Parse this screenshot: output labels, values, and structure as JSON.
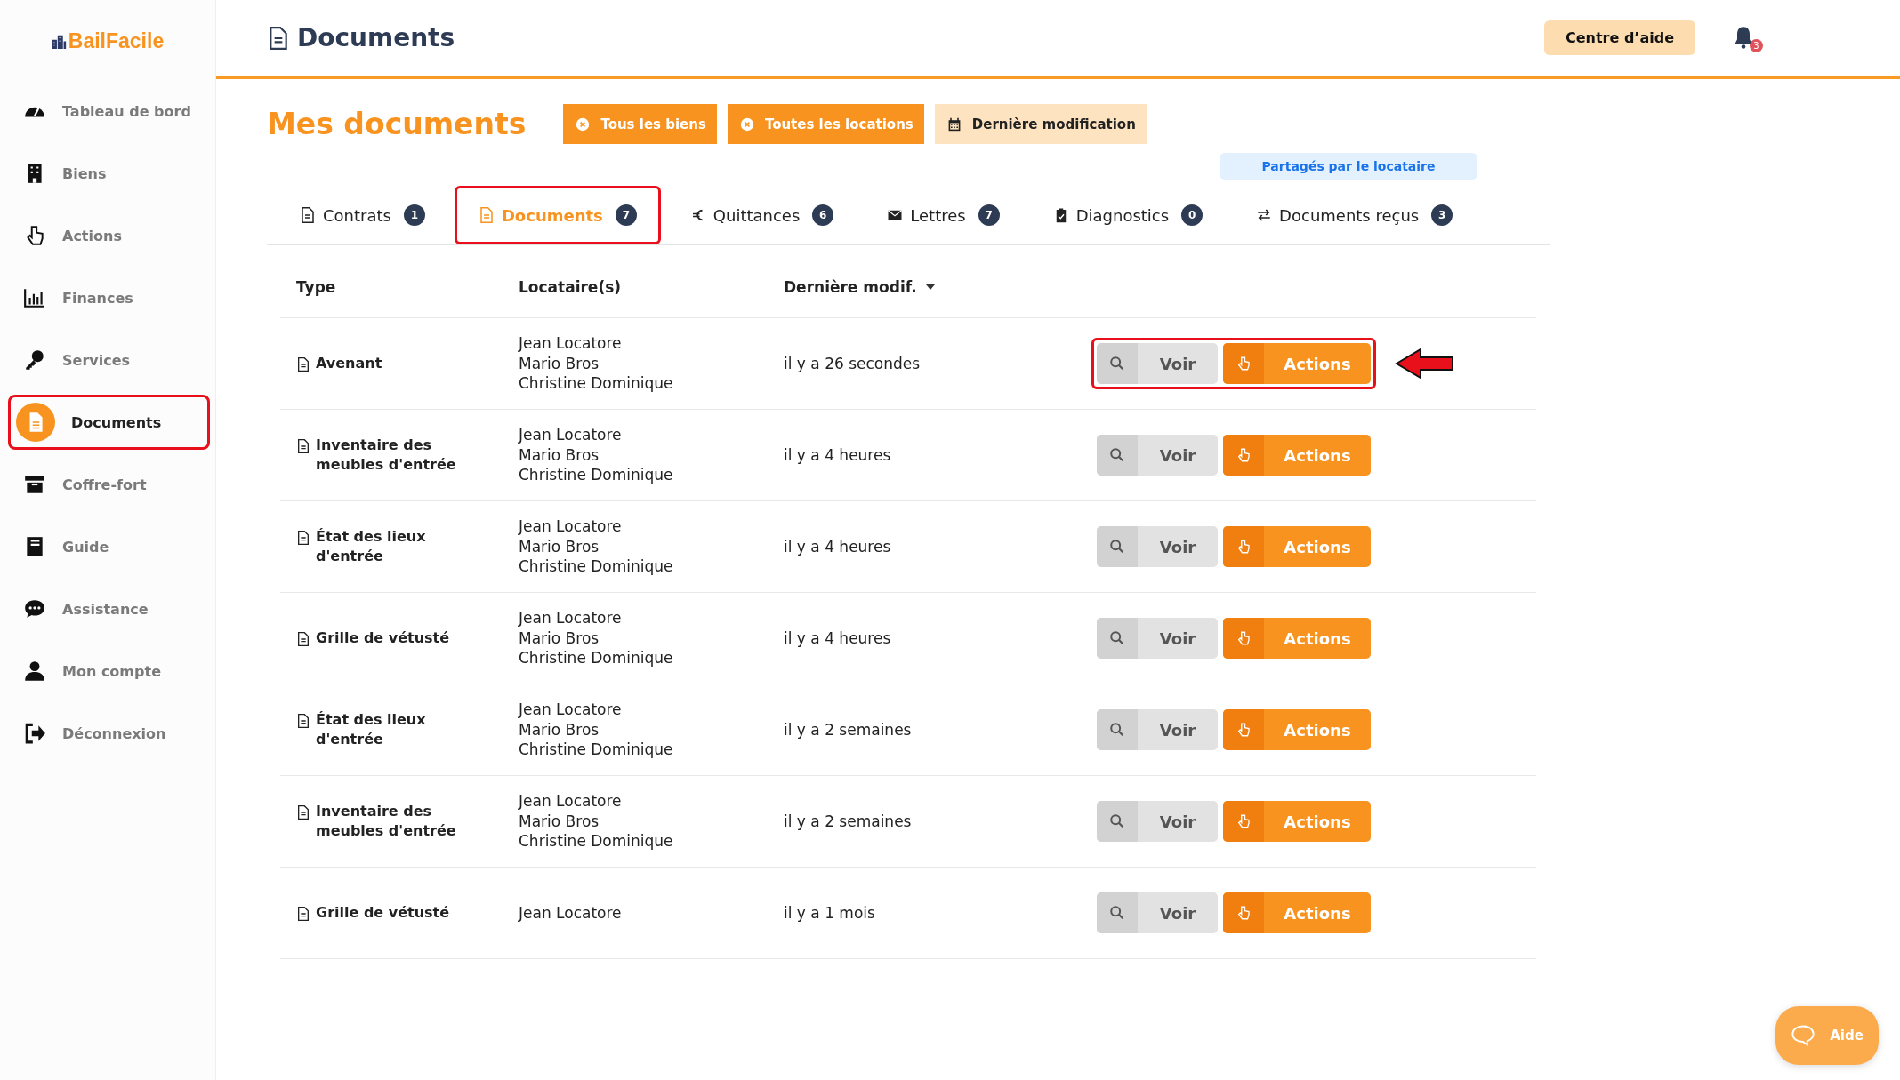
{
  "sidebar": {
    "logo": "BailFacile",
    "items": [
      {
        "label": "Tableau de bord",
        "selected": false,
        "highlighted": false
      },
      {
        "label": "Biens",
        "selected": false,
        "highlighted": false
      },
      {
        "label": "Actions",
        "selected": false,
        "highlighted": false
      },
      {
        "label": "Finances",
        "selected": false,
        "highlighted": false
      },
      {
        "label": "Services",
        "selected": false,
        "highlighted": false
      },
      {
        "label": "Documents",
        "selected": true,
        "highlighted": true
      },
      {
        "label": "Coffre-fort",
        "selected": false,
        "highlighted": false
      },
      {
        "label": "Guide",
        "selected": false,
        "highlighted": false
      },
      {
        "label": "Assistance",
        "selected": false,
        "highlighted": false
      },
      {
        "label": "Mon compte",
        "selected": false,
        "highlighted": false
      },
      {
        "label": "Déconnexion",
        "selected": false,
        "highlighted": false
      }
    ]
  },
  "header": {
    "title": "Documents",
    "help_button": "Centre d’aide",
    "notification_count": "3"
  },
  "page_title": "Mes documents",
  "filters": [
    {
      "label": "Tous les biens",
      "kind": "removable"
    },
    {
      "label": "Toutes les locations",
      "kind": "removable"
    },
    {
      "label": "Dernière modification",
      "kind": "sort"
    }
  ],
  "shared_label": "Partagés par le locataire",
  "tabs": [
    {
      "label": "Contrats",
      "count": "1",
      "selected": false,
      "highlighted": false
    },
    {
      "label": "Documents",
      "count": "7",
      "selected": true,
      "highlighted": true
    },
    {
      "label": "Quittances",
      "count": "6",
      "selected": false,
      "highlighted": false
    },
    {
      "label": "Lettres",
      "count": "7",
      "selected": false,
      "highlighted": false
    },
    {
      "label": "Diagnostics",
      "count": "0",
      "selected": false,
      "highlighted": false
    },
    {
      "label": "Documents reçus",
      "count": "3",
      "selected": false,
      "highlighted": false
    }
  ],
  "table": {
    "columns": [
      {
        "label": "Type",
        "sorted": false
      },
      {
        "label": "Locataire(s)",
        "sorted": false
      },
      {
        "label": "Dernière modif.",
        "sorted": true
      }
    ],
    "rows": [
      {
        "type": "Avenant",
        "tenants": [
          "Jean Locatore",
          "Mario Bros",
          "Christine Dominique"
        ],
        "modified": "il y a 26 secondes",
        "view": "Voir",
        "actions": "Actions",
        "highlighted": true,
        "arrow": true
      },
      {
        "type": "Inventaire des meubles d'entrée",
        "tenants": [
          "Jean Locatore",
          "Mario Bros",
          "Christine Dominique"
        ],
        "modified": "il y a 4 heures",
        "view": "Voir",
        "actions": "Actions",
        "highlighted": false,
        "arrow": false
      },
      {
        "type": "État des lieux d'entrée",
        "tenants": [
          "Jean Locatore",
          "Mario Bros",
          "Christine Dominique"
        ],
        "modified": "il y a 4 heures",
        "view": "Voir",
        "actions": "Actions",
        "highlighted": false,
        "arrow": false
      },
      {
        "type": "Grille de vétusté",
        "tenants": [
          "Jean Locatore",
          "Mario Bros",
          "Christine Dominique"
        ],
        "modified": "il y a 4 heures",
        "view": "Voir",
        "actions": "Actions",
        "highlighted": false,
        "arrow": false
      },
      {
        "type": "État des lieux d'entrée",
        "tenants": [
          "Jean Locatore",
          "Mario Bros",
          "Christine Dominique"
        ],
        "modified": "il y a 2 semaines",
        "view": "Voir",
        "actions": "Actions",
        "highlighted": false,
        "arrow": false
      },
      {
        "type": "Inventaire des meubles d'entrée",
        "tenants": [
          "Jean Locatore",
          "Mario Bros",
          "Christine Dominique"
        ],
        "modified": "il y a 2 semaines",
        "view": "Voir",
        "actions": "Actions",
        "highlighted": false,
        "arrow": false
      },
      {
        "type": "Grille de vétusté",
        "tenants": [
          "Jean Locatore"
        ],
        "modified": "il y a 1 mois",
        "view": "Voir",
        "actions": "Actions",
        "highlighted": false,
        "arrow": false
      }
    ]
  },
  "help_widget": "Aide"
}
